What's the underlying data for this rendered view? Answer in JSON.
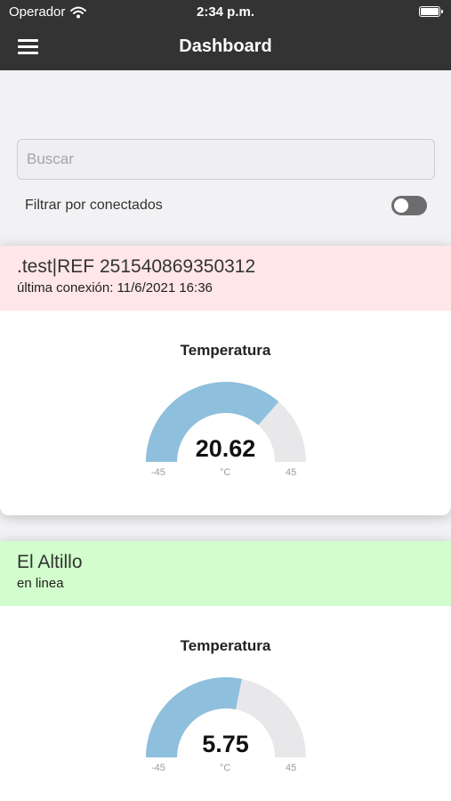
{
  "status_bar": {
    "carrier": "Operador",
    "time": "2:34 p.m."
  },
  "navbar": {
    "title": "Dashboard",
    "menu_icon": "hamburger-menu-icon"
  },
  "search": {
    "placeholder": "Buscar",
    "value": ""
  },
  "filter": {
    "label": "Filtrar por conectados",
    "enabled": false
  },
  "colors": {
    "navbar": "#333333",
    "offline_header": "#ffe6e8",
    "online_header": "#d2fdcc",
    "gauge_fill": "#8ebfdc",
    "gauge_track": "#e8e8ea"
  },
  "devices": [
    {
      "name": ".test|REF 251540869350312",
      "status": "última conexión: 11/6/2021 16:36",
      "online": false,
      "gauge": {
        "title": "Temperatura",
        "value": "20.62",
        "unit": "°C",
        "min": "-45",
        "max": "45",
        "numeric_value": 20.62,
        "range": [
          -45,
          45
        ]
      }
    },
    {
      "name": "El Altillo",
      "status": "en linea",
      "online": true,
      "gauge": {
        "title": "Temperatura",
        "value": "5.75",
        "unit": "°C",
        "min": "-45",
        "max": "45",
        "numeric_value": 5.75,
        "range": [
          -45,
          45
        ]
      }
    }
  ]
}
